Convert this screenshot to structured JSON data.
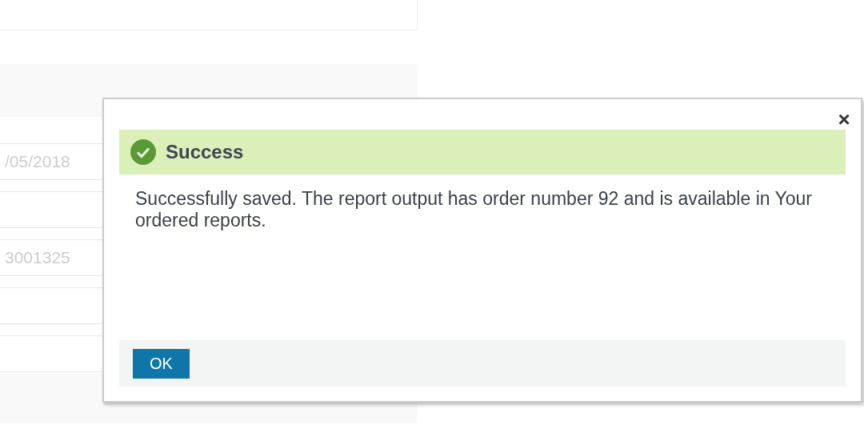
{
  "background_form": {
    "fields": [
      {
        "value": "/05/2018"
      },
      {
        "value": "3001325"
      }
    ]
  },
  "dialog": {
    "title": "Success",
    "message": "Successfully saved. The report output has order number 92 and is available in Your ordered reports.",
    "close": "×",
    "buttons": [
      "OK"
    ]
  }
}
